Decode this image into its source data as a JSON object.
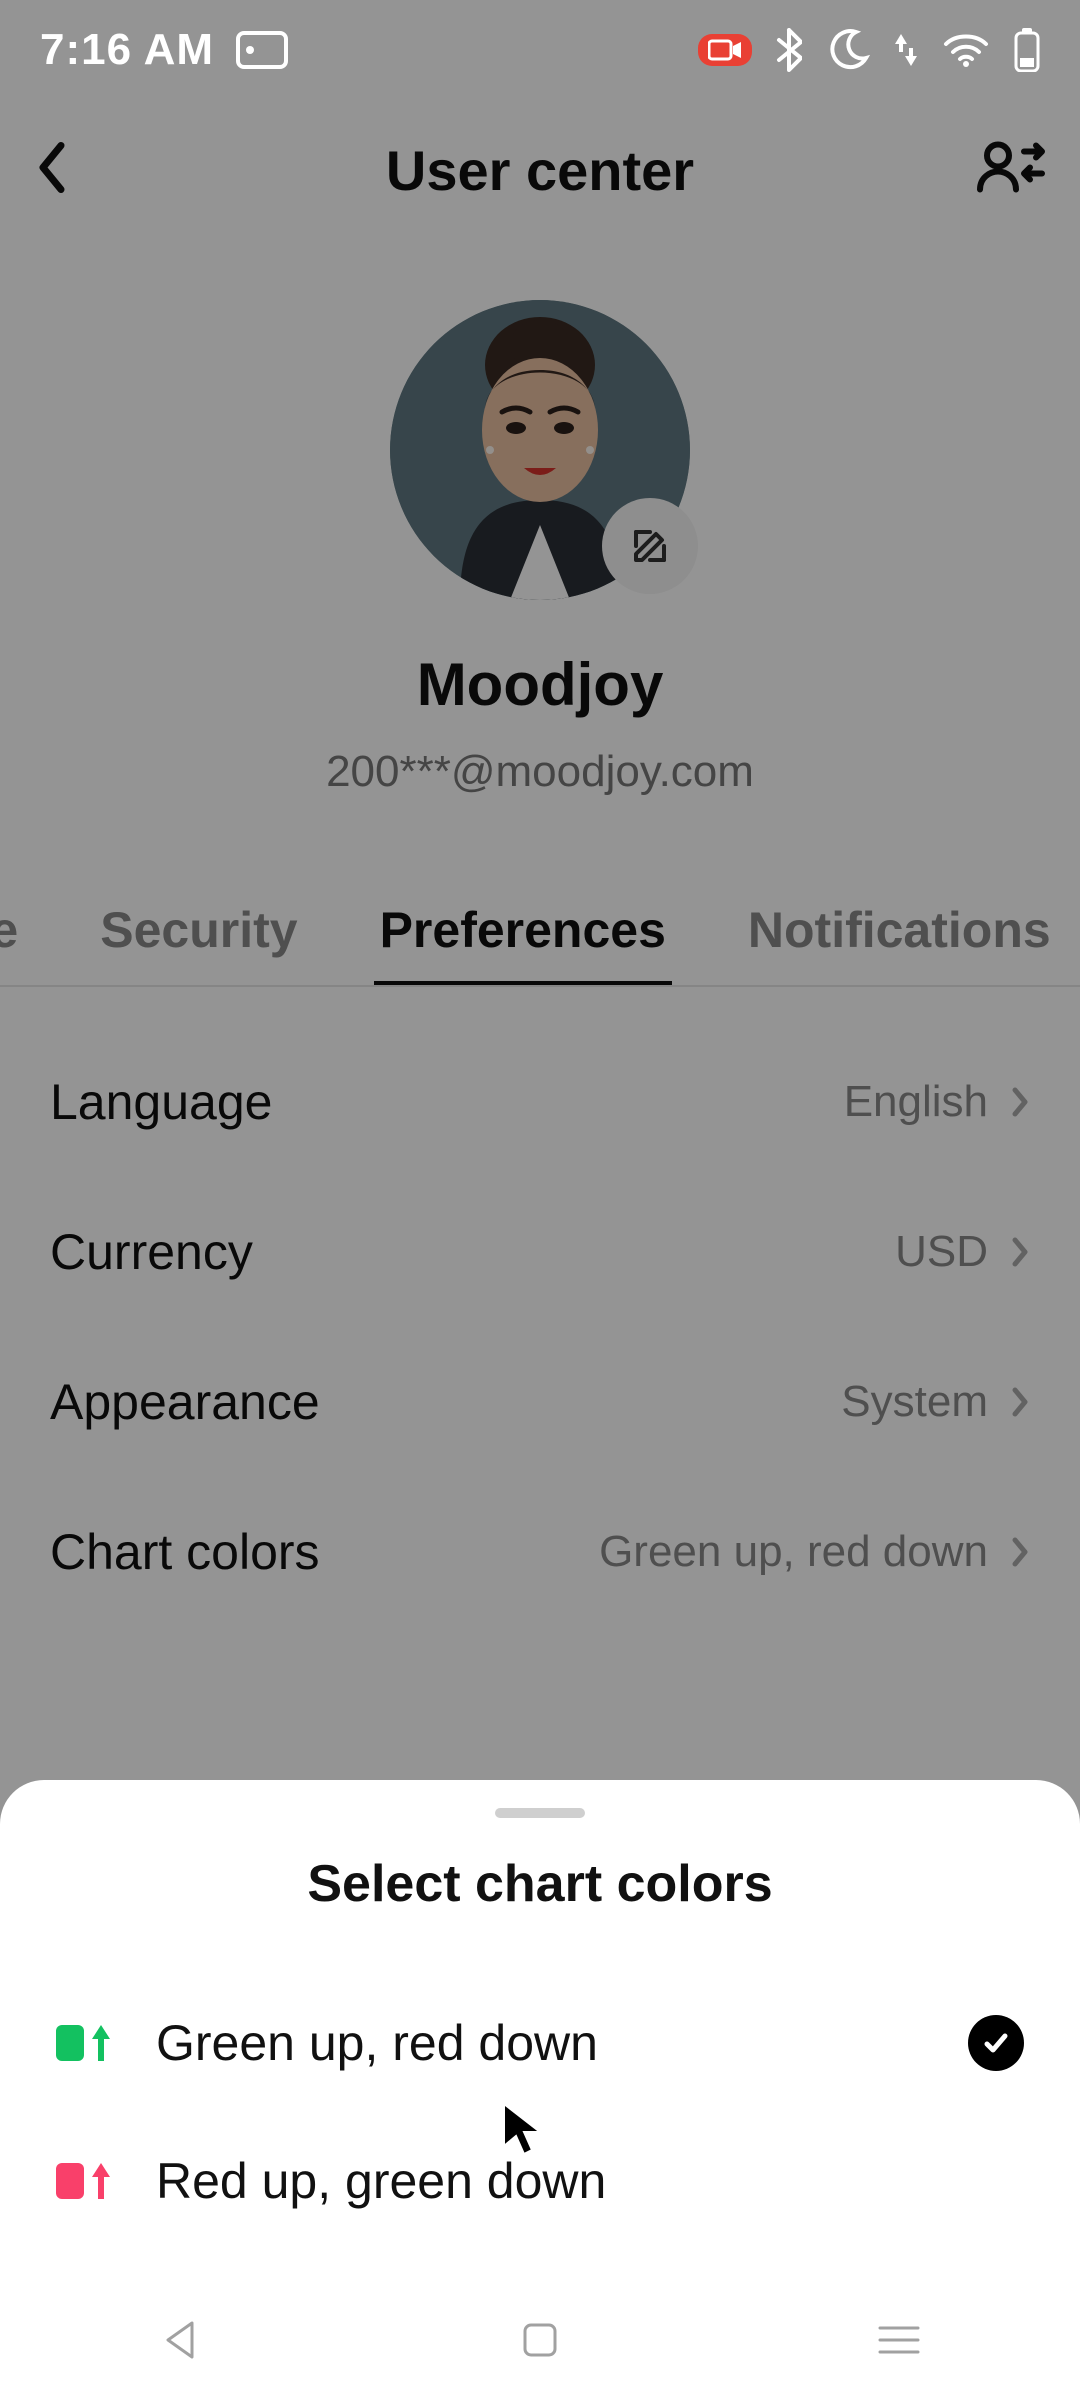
{
  "statusbar": {
    "time": "7:16 AM"
  },
  "header": {
    "title": "User center"
  },
  "profile": {
    "name": "Moodjoy",
    "email": "200***@moodjoy.com"
  },
  "tabs": {
    "items": [
      {
        "label": "file"
      },
      {
        "label": "Security"
      },
      {
        "label": "Preferences"
      },
      {
        "label": "Notifications"
      }
    ],
    "activeIndex": 2
  },
  "settings": {
    "rows": [
      {
        "label": "Language",
        "value": "English"
      },
      {
        "label": "Currency",
        "value": "USD"
      },
      {
        "label": "Appearance",
        "value": "System"
      },
      {
        "label": "Chart colors",
        "value": "Green up, red down"
      }
    ]
  },
  "sheet": {
    "title": "Select chart colors",
    "options": [
      {
        "label": "Green up, red down",
        "color": "#13c160",
        "selected": true
      },
      {
        "label": "Red up, green down",
        "color": "#f9406a",
        "selected": false
      }
    ]
  }
}
